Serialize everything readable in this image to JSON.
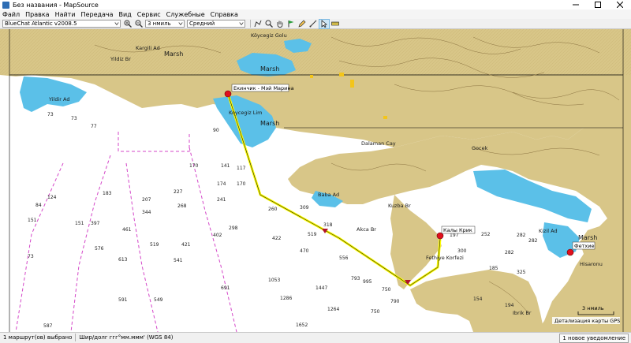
{
  "window": {
    "title": "Без названия - MapSource"
  },
  "menu": [
    "Файл",
    "Правка",
    "Найти",
    "Передача",
    "Вид",
    "Сервис",
    "Служебные",
    "Справка"
  ],
  "toolbar": {
    "map_product": "BlueChat Atlantic v2008.5",
    "zoom_level": "3 нмиль",
    "detail_level": "Средний"
  },
  "map": {
    "colors": {
      "land": "#d8c688",
      "water": "#ffffff",
      "shallow": "#5bc0e8",
      "route": "#ffff00"
    },
    "place_labels": [
      {
        "id": "marsh-1",
        "text": "Marsh"
      },
      {
        "id": "marsh-2",
        "text": "Marsh"
      },
      {
        "id": "marsh-3",
        "text": "Marsh"
      },
      {
        "id": "marsh-4",
        "text": "Marsh"
      },
      {
        "id": "koycegiz-golu",
        "text": "Köycegiz Golu"
      },
      {
        "id": "dalaman-cay",
        "text": "Dalaman Cay"
      },
      {
        "id": "baba-ad",
        "text": "Baba Ad"
      },
      {
        "id": "akca-br",
        "text": "Akca Br"
      },
      {
        "id": "kuzba-br",
        "text": "Kuzba Br"
      },
      {
        "id": "kizil-ad",
        "text": "Kizil Ad"
      },
      {
        "id": "gocek",
        "text": "Gocek"
      },
      {
        "id": "fethiye-korfezi",
        "text": "Fethiye Korfezi"
      },
      {
        "id": "hisaronu",
        "text": "Hisaronu"
      },
      {
        "id": "ibrik-br",
        "text": "Ibrik Br"
      },
      {
        "id": "yildir-ad",
        "text": "Yildir Ad"
      },
      {
        "id": "kargili-ad",
        "text": "Kargili Ad"
      },
      {
        "id": "koycegiz-lim",
        "text": "Koycegiz Lim"
      },
      {
        "id": "yildiz-burnu",
        "text": "Yildiz Br"
      }
    ],
    "waypoints": [
      {
        "id": "ekincik",
        "label": "Екинчик - Мэй Марина"
      },
      {
        "id": "kalyi-krik",
        "label": "Калы Крик"
      },
      {
        "id": "fethiye",
        "label": "Фетхие"
      }
    ],
    "scale_label": "3 нмиль",
    "detail_label": "Детализация карты GPS"
  },
  "status": {
    "selection": "1 маршрут(ов) выбрано",
    "coords": "Шир/долг ггг°мм.ммм' (WGS 84)",
    "notification": "1 новое уведомление"
  }
}
